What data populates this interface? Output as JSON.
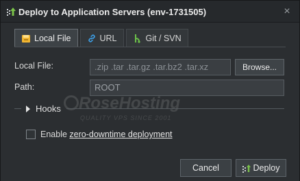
{
  "window": {
    "title": "Deploy to Application Servers (env-1731505)",
    "close_label": "×"
  },
  "tabs": [
    {
      "label": "Local File",
      "icon": "folder-icon",
      "active": true
    },
    {
      "label": "URL",
      "icon": "link-icon",
      "active": false
    },
    {
      "label": "Git / SVN",
      "icon": "git-branch-icon",
      "active": false
    }
  ],
  "form": {
    "local_file": {
      "label": "Local File:",
      "placeholder": ".zip .tar .tar.gz .tar.bz2 .tar.xz",
      "browse_label": "Browse..."
    },
    "path": {
      "label": "Path:",
      "value": "ROOT"
    },
    "hooks_label": "Hooks",
    "zero_downtime": {
      "prefix": "Enable",
      "link": "zero-downtime deployment",
      "checked": false
    }
  },
  "watermark": {
    "main": "RoseHosting",
    "sub": "QUALITY VPS SINCE 2001"
  },
  "footer": {
    "cancel_label": "Cancel",
    "deploy_label": "Deploy"
  },
  "colors": {
    "folder_icon": "#f2b632",
    "link_icon": "#3da0e8",
    "git_icon": "#6cc04a",
    "deploy_icon": "#7bc34a"
  }
}
